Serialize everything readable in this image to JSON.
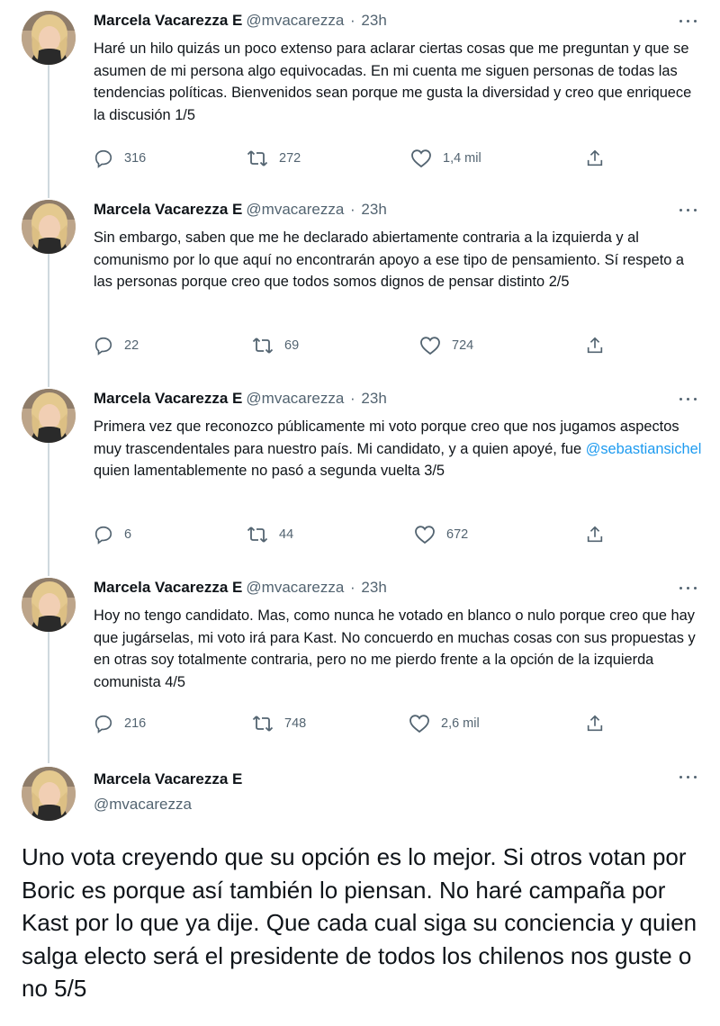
{
  "author": {
    "name": "Marcela Vacarezza E",
    "handle": "@mvacarezza"
  },
  "thread": [
    {
      "time": "23h",
      "text_before": "Haré un hilo quizás un poco extenso para aclarar ciertas cosas que me preguntan y que se asumen de mi persona algo equivocadas. En mi cuenta me siguen personas de todas las tendencias políticas. Bienvenidos sean porque me gusta la diversidad y creo que enriquece la discusión 1/5",
      "mention": "",
      "text_after": "",
      "replies": "316",
      "retweets": "272",
      "likes": "1,4 mil"
    },
    {
      "time": "23h",
      "text_before": "Sin embargo, saben que me he declarado abiertamente contraria a la izquierda y al comunismo por lo que aquí no encontrarán apoyo a ese tipo de pensamiento. Sí respeto a las personas porque creo que todos somos dignos de pensar distinto 2/5",
      "mention": "",
      "text_after": "",
      "replies": "22",
      "retweets": "69",
      "likes": "724"
    },
    {
      "time": "23h",
      "text_before": "Primera vez que reconozco públicamente mi voto porque creo que nos jugamos aspectos muy trascendentales para nuestro país. Mi candidato, y a quien apoyé, fue ",
      "mention": "@sebastiansichel",
      "text_after": " quien lamentablemente no pasó a segunda vuelta 3/5",
      "replies": "6",
      "retweets": "44",
      "likes": "672"
    },
    {
      "time": "23h",
      "text_before": "Hoy no tengo candidato. Mas, como nunca he votado en blanco o nulo porque creo que hay que jugárselas, mi voto irá para Kast. No concuerdo en muchas cosas con sus propuestas y en otras soy totalmente contraria, pero no me pierdo frente a la opción de la izquierda comunista 4/5",
      "mention": "",
      "text_after": "",
      "replies": "216",
      "retweets": "748",
      "likes": "2,6 mil"
    }
  ],
  "main_tweet": {
    "text": "Uno vota creyendo que su opción es lo mejor. Si otros votan por Boric es porque así también lo piensan. No haré campaña por Kast por lo que ya dije. Que cada cual siga su conciencia y quien salga electo será el presidente de todos los chilenos nos guste o no 5/5"
  },
  "icons": {
    "reply": "reply-icon",
    "retweet": "retweet-icon",
    "like": "like-icon",
    "share": "share-icon",
    "more": "more-icon"
  },
  "colors": {
    "text": "#0f1419",
    "secondary": "#536471",
    "link": "#1d9bf0",
    "thread_line": "#cfd9de"
  }
}
